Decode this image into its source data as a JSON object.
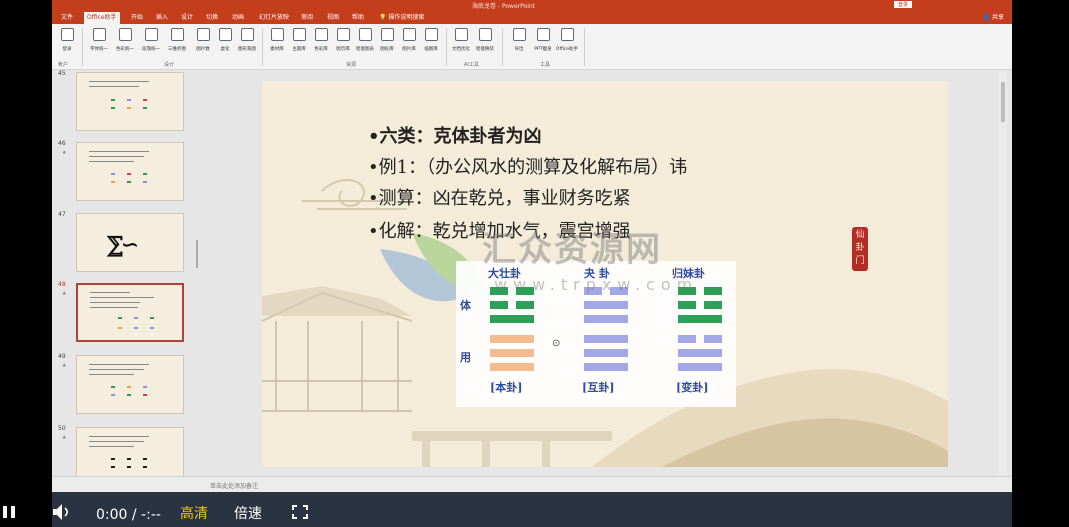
{
  "window": {
    "title": "海底龙卷  -  PowerPoint",
    "signin": "登录"
  },
  "menu": {
    "tabs": [
      "文件",
      "Office助手",
      "开始",
      "插入",
      "设计",
      "切换",
      "动画",
      "幻灯片放映",
      "审阅",
      "视图",
      "帮助",
      "操作说明搜索"
    ],
    "active": "Office助手",
    "share": "共享"
  },
  "ribbon": {
    "buttons": [
      "登录",
      "字体统一",
      "色彩统一",
      "段落统一",
      "三维折图",
      "图片数",
      "虚化",
      "图形裁图",
      "素材库",
      "主题库",
      "色彩库",
      "图示库",
      "智能图表",
      "图标库",
      "图片库",
      "插图库",
      "文档优化",
      "智能换装",
      "导出",
      "PPT瘦身",
      "Office助手"
    ],
    "groups": [
      "帐户",
      "设计",
      "资源",
      "AI工具",
      "工具"
    ]
  },
  "thumbnails": {
    "numbers": [
      "45",
      "46",
      "47",
      "48",
      "49",
      "50"
    ],
    "active": "48"
  },
  "slide": {
    "bullets": [
      "•六类：克体卦者为凶",
      "•例1：（办公风水的测算及化解布局）讳",
      "•测算：凶在乾兑，事业财务吃紧",
      "•化解：乾兑增加水气，震宫增强"
    ],
    "hex_titles": [
      "大壮卦",
      "夬 卦",
      "归妹卦"
    ],
    "hex_captions": [
      "[本卦]",
      "[互卦]",
      "[变卦]"
    ],
    "side_labels": [
      "体",
      "用"
    ],
    "seal_text": "仙卦门",
    "watermark": "汇众资源网",
    "watermark_url": "www.trpxw.com",
    "colors": {
      "green": "#1f9a4e",
      "orange": "#f6b98a",
      "purple": "#9fa2e6",
      "blue_text": "#1f3f99"
    }
  },
  "notes": {
    "placeholder": "单击此处添加备注"
  },
  "player": {
    "time": "0:00 / -:--",
    "quality": "高清",
    "speed": "倍速"
  }
}
